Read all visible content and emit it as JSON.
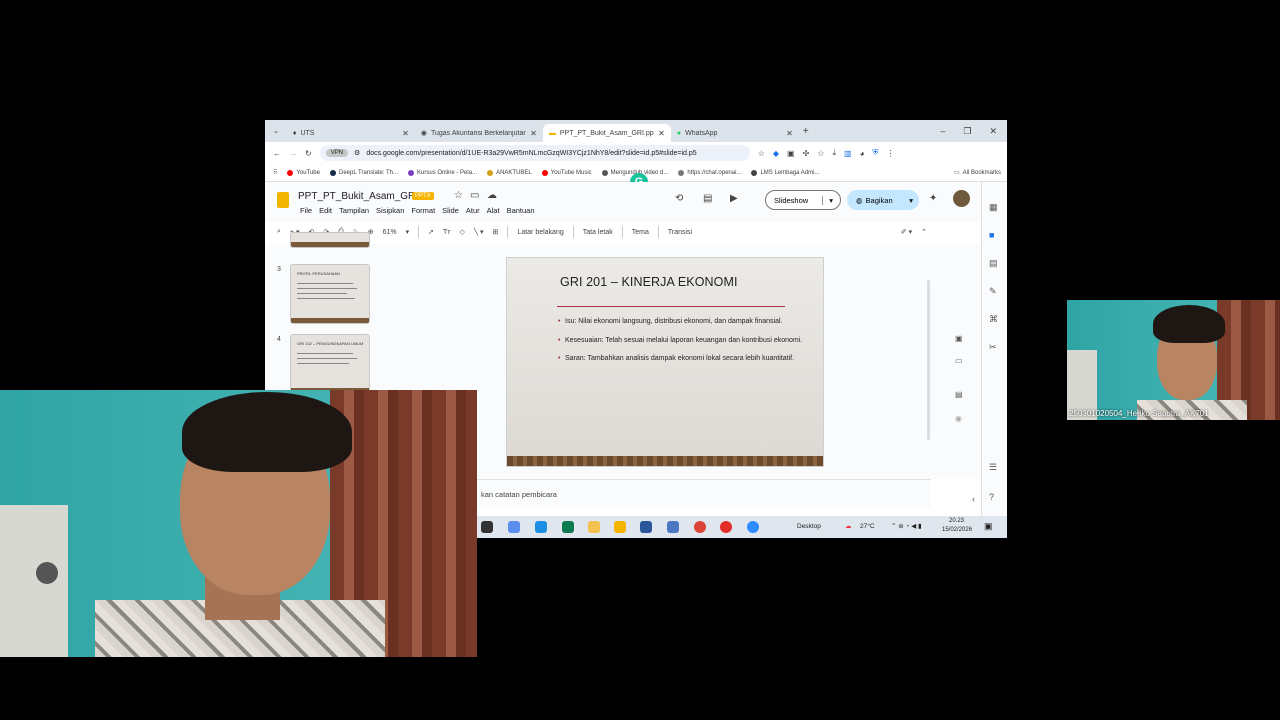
{
  "browser": {
    "tabs": [
      {
        "title": "UTS",
        "active": false
      },
      {
        "title": "Tugas Akuntansi Berkelanjutan",
        "active": false
      },
      {
        "title": "PPT_PT_Bukit_Asam_GRI.pptx -",
        "active": true
      },
      {
        "title": "WhatsApp",
        "active": false
      }
    ],
    "new_tab": "+",
    "url": "docs.google.com/presentation/d/1UE-R3a29VwR5mNLmcGzqWI3YCjz1NhY8/edit?slide=id.p5#slide=id.p5",
    "url_chip": "VPN",
    "bookmarks": [
      "YouTube",
      "DeepL Translate: Th...",
      "Kursus Online - Pela...",
      "ANAKTUBEL",
      "YouTube Music",
      "Mengunduh video d...",
      "https://chat.openai...",
      "LMS Lembaga Admi..."
    ],
    "all_bookmarks": "All Bookmarks"
  },
  "doc": {
    "title": "PPT_PT_Bukit_Asam_GRI",
    "badge": "PPTX",
    "menu": [
      "File",
      "Edit",
      "Tampilan",
      "Sisipkan",
      "Format",
      "Slide",
      "Atur",
      "Alat",
      "Bantuan"
    ],
    "slideshow_label": "Slideshow",
    "share_label": "Bagikan",
    "zoom": "61%",
    "toolbar_text": [
      "Latar belakang",
      "Tata letak",
      "Tema",
      "Transisi"
    ],
    "notes_placeholder": "kan catatan pembicara"
  },
  "filmstrip": {
    "items": [
      {
        "number": "3",
        "title": "PROFIL PERUSAHAAN"
      },
      {
        "number": "4",
        "title": "GRI 102 – PENGUNGKAPAN UMUM"
      }
    ]
  },
  "slide": {
    "title": "GRI 201 – KINERJA EKONOMI",
    "bullets": [
      "Isu: Nilai ekonomi langsung, distribusi ekonomi, dan dampak finansial.",
      "Kesesuaian: Telah sesuai melalui laporan keuangan dan kontribusi ekonomi.",
      "Saran: Tambahkan analisis dampak ekonomi lokal secara lebih kuantitatif."
    ]
  },
  "taskbar": {
    "desktop_label": "Desktop",
    "weather": "27°C",
    "time": "20.23",
    "date": "15/02/2026"
  },
  "participants": {
    "small_label": "250301020504_Heriko Saputra_AK701"
  },
  "colors": {
    "slides_yellow": "#f4b400",
    "share_blue": "#c2e7ff",
    "accent_red": "#b03040"
  }
}
